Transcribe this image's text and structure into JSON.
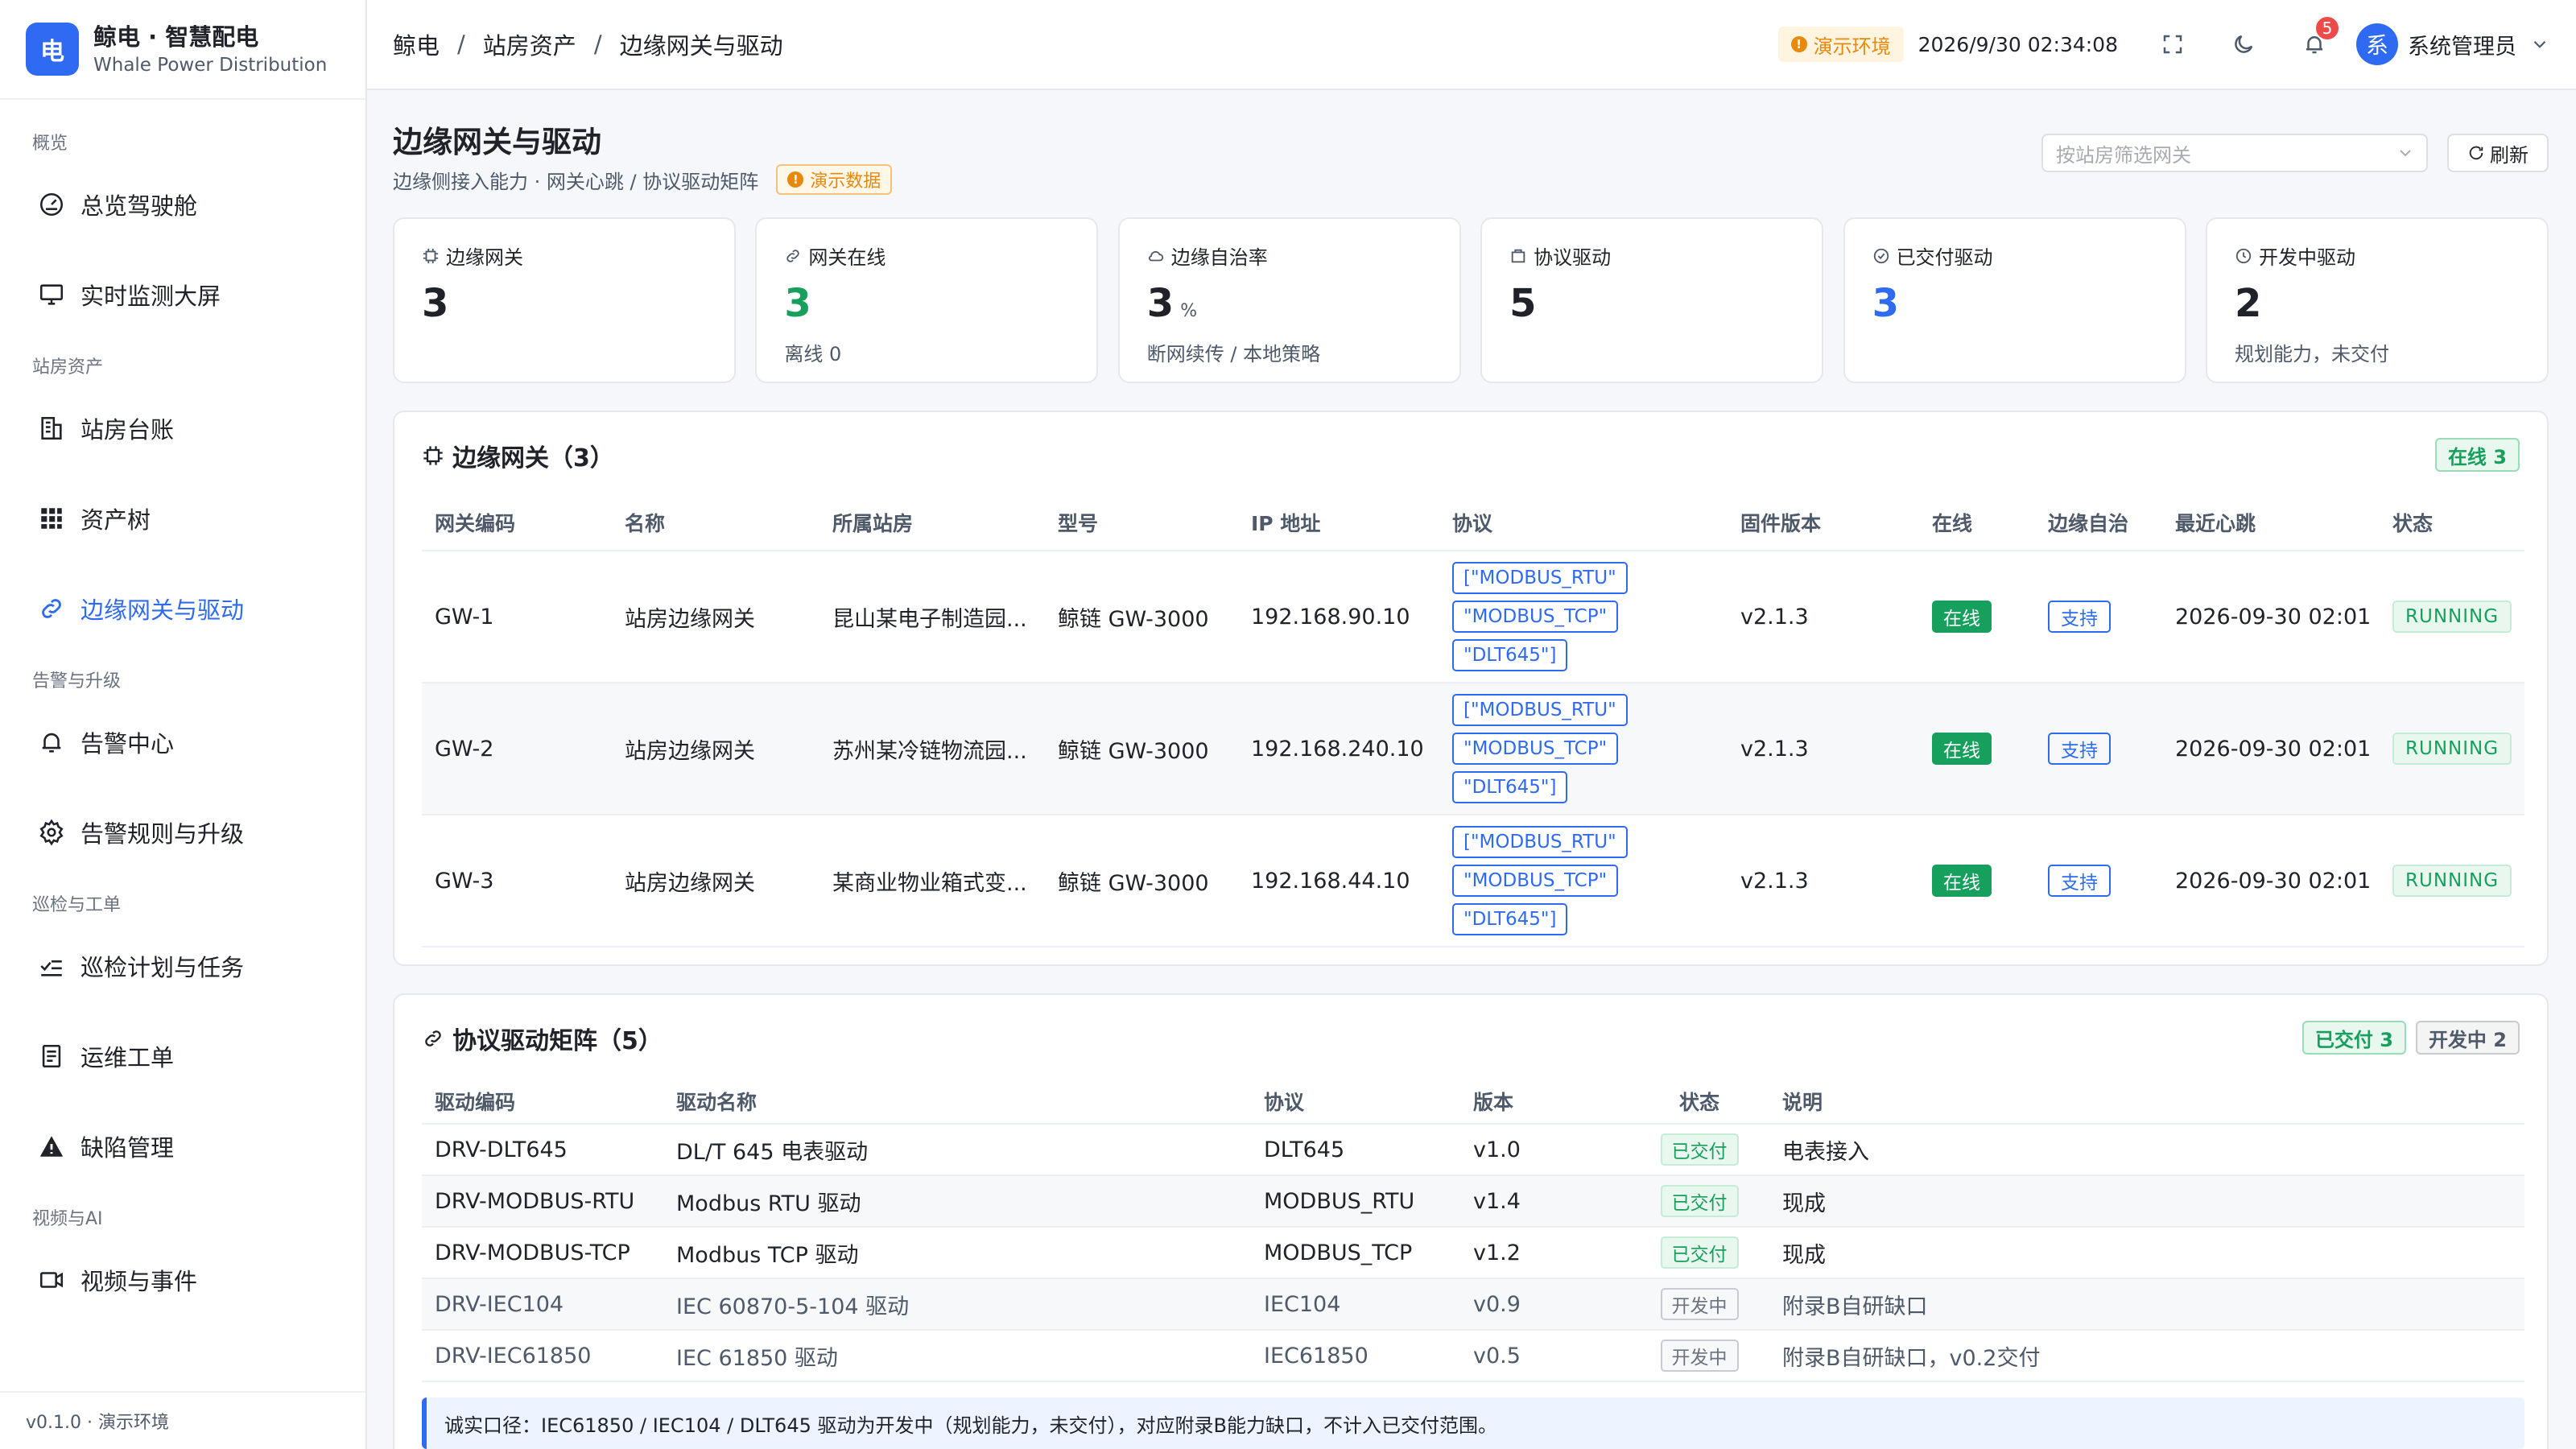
{
  "brand": {
    "logo": "电",
    "title": "鲸电 · 智慧配电",
    "subtitle": "Whale Power Distribution"
  },
  "sidebar": {
    "groups": [
      {
        "label": "概览",
        "items": [
          {
            "label": "总览驾驶舱",
            "icon": "dashboard-icon"
          },
          {
            "label": "实时监测大屏",
            "icon": "monitor-icon"
          }
        ]
      },
      {
        "label": "站房资产",
        "items": [
          {
            "label": "站房台账",
            "icon": "building-icon"
          },
          {
            "label": "资产树",
            "icon": "grid-icon"
          },
          {
            "label": "边缘网关与驱动",
            "icon": "link-icon",
            "active": true
          }
        ]
      },
      {
        "label": "告警与升级",
        "items": [
          {
            "label": "告警中心",
            "icon": "bell-icon"
          },
          {
            "label": "告警规则与升级",
            "icon": "gear-icon"
          }
        ]
      },
      {
        "label": "巡检与工单",
        "items": [
          {
            "label": "巡检计划与任务",
            "icon": "checklist-icon"
          },
          {
            "label": "运维工单",
            "icon": "document-icon"
          },
          {
            "label": "缺陷管理",
            "icon": "warning-icon"
          }
        ]
      },
      {
        "label": "视频与AI",
        "items": [
          {
            "label": "视频与事件",
            "icon": "video-icon"
          }
        ]
      }
    ],
    "footer": "v0.1.0 · 演示环境"
  },
  "header": {
    "breadcrumb": [
      "鲸电",
      "站房资产",
      "边缘网关与驱动"
    ],
    "env_tag": "演示环境",
    "datetime": "2026/9/30 02:34:08",
    "notification_count": "5",
    "avatar_text": "系",
    "user_name": "系统管理员"
  },
  "page": {
    "title": "边缘网关与驱动",
    "subtitle": "边缘侧接入能力 · 网关心跳 / 协议驱动矩阵",
    "demo_badge": "演示数据",
    "filter_placeholder": "按站房筛选网关",
    "refresh_label": "刷新"
  },
  "stats": [
    {
      "label": "边缘网关",
      "value": "3",
      "unit": "",
      "sub": ""
    },
    {
      "label": "网关在线",
      "value": "3",
      "unit": "",
      "sub": "离线 0"
    },
    {
      "label": "边缘自治率",
      "value": "3",
      "unit": "%",
      "sub": "断网续传 / 本地策略"
    },
    {
      "label": "协议驱动",
      "value": "5",
      "unit": "",
      "sub": ""
    },
    {
      "label": "已交付驱动",
      "value": "3",
      "unit": "",
      "sub": ""
    },
    {
      "label": "开发中驱动",
      "value": "2",
      "unit": "",
      "sub": "规划能力，未交付"
    }
  ],
  "gateways": {
    "title": "边缘网关（3）",
    "online_tag": "在线 3",
    "columns": [
      "网关编码",
      "名称",
      "所属站房",
      "型号",
      "IP 地址",
      "协议",
      "固件版本",
      "在线",
      "边缘自治",
      "最近心跳",
      "状态"
    ],
    "rows": [
      {
        "code": "GW-1",
        "name": "站房边缘网关",
        "station": "昆山某电子制造园...",
        "model": "鲸链 GW-3000",
        "ip": "192.168.90.10",
        "protocols": [
          "[\"MODBUS_RTU\"",
          "\"MODBUS_TCP\"",
          "\"DLT645\"]"
        ],
        "firmware": "v2.1.3",
        "online": "在线",
        "autonomy": "支持",
        "heartbeat": "2026-09-30 02:01",
        "status": "RUNNING"
      },
      {
        "code": "GW-2",
        "name": "站房边缘网关",
        "station": "苏州某冷链物流园...",
        "model": "鲸链 GW-3000",
        "ip": "192.168.240.10",
        "protocols": [
          "[\"MODBUS_RTU\"",
          "\"MODBUS_TCP\"",
          "\"DLT645\"]"
        ],
        "firmware": "v2.1.3",
        "online": "在线",
        "autonomy": "支持",
        "heartbeat": "2026-09-30 02:01",
        "status": "RUNNING"
      },
      {
        "code": "GW-3",
        "name": "站房边缘网关",
        "station": "某商业物业箱式变...",
        "model": "鲸链 GW-3000",
        "ip": "192.168.44.10",
        "protocols": [
          "[\"MODBUS_RTU\"",
          "\"MODBUS_TCP\"",
          "\"DLT645\"]"
        ],
        "firmware": "v2.1.3",
        "online": "在线",
        "autonomy": "支持",
        "heartbeat": "2026-09-30 02:01",
        "status": "RUNNING"
      }
    ]
  },
  "drivers": {
    "title": "协议驱动矩阵（5）",
    "delivered_tag": "已交付 3",
    "dev_tag": "开发中 2",
    "columns": [
      "驱动编码",
      "驱动名称",
      "协议",
      "版本",
      "状态",
      "说明"
    ],
    "rows": [
      {
        "code": "DRV-DLT645",
        "name": "DL/T 645 电表驱动",
        "protocol": "DLT645",
        "version": "v1.0",
        "status": "已交付",
        "note": "电表接入"
      },
      {
        "code": "DRV-MODBUS-RTU",
        "name": "Modbus RTU 驱动",
        "protocol": "MODBUS_RTU",
        "version": "v1.4",
        "status": "已交付",
        "note": "现成"
      },
      {
        "code": "DRV-MODBUS-TCP",
        "name": "Modbus TCP 驱动",
        "protocol": "MODBUS_TCP",
        "version": "v1.2",
        "status": "已交付",
        "note": "现成"
      },
      {
        "code": "DRV-IEC104",
        "name": "IEC 60870-5-104 驱动",
        "protocol": "IEC104",
        "version": "v0.9",
        "status": "开发中",
        "note": "附录B自研缺口"
      },
      {
        "code": "DRV-IEC61850",
        "name": "IEC 61850 驱动",
        "protocol": "IEC61850",
        "version": "v0.5",
        "status": "开发中",
        "note": "附录B自研缺口，v0.2交付"
      }
    ],
    "footnote": "诚实口径：IEC61850 / IEC104 / DLT645 驱动为开发中（规划能力，未交付），对应附录B能力缺口，不计入已交付范围。"
  }
}
